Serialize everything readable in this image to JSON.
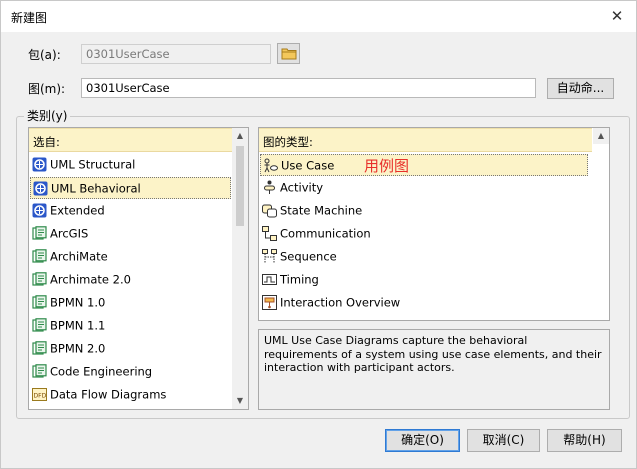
{
  "window": {
    "title": "新建图",
    "close_glyph": "✕"
  },
  "package": {
    "label": "包(a):",
    "value": "0301UserCase"
  },
  "diagram": {
    "label": "图(m):",
    "value": "0301UserCase",
    "auto_name_button": "自动命..."
  },
  "category": {
    "group_label": "类别(y)",
    "from_header": "选自:",
    "types_header": "图的类型:",
    "from_items": [
      {
        "label": "UML Structural",
        "icon": "uml-icon"
      },
      {
        "label": "UML Behavioral",
        "icon": "uml-icon",
        "selected": true
      },
      {
        "label": "Extended",
        "icon": "uml-icon"
      },
      {
        "label": "ArcGIS",
        "icon": "model-icon"
      },
      {
        "label": "ArchiMate",
        "icon": "model-icon"
      },
      {
        "label": "Archimate 2.0",
        "icon": "model-icon"
      },
      {
        "label": "BPMN 1.0",
        "icon": "model-icon"
      },
      {
        "label": "BPMN 1.1",
        "icon": "model-icon"
      },
      {
        "label": "BPMN 2.0",
        "icon": "model-icon"
      },
      {
        "label": "Code Engineering",
        "icon": "model-icon"
      },
      {
        "label": "Data Flow Diagrams",
        "icon": "dfd-icon"
      }
    ],
    "type_items": [
      {
        "label": "Use Case",
        "icon": "use-case-icon",
        "selected": true
      },
      {
        "label": "Activity",
        "icon": "activity-icon"
      },
      {
        "label": "State Machine",
        "icon": "state-machine-icon"
      },
      {
        "label": "Communication",
        "icon": "communication-icon"
      },
      {
        "label": "Sequence",
        "icon": "sequence-icon"
      },
      {
        "label": "Timing",
        "icon": "timing-icon"
      },
      {
        "label": "Interaction Overview",
        "icon": "interaction-overview-icon"
      }
    ],
    "annotation": "用例图",
    "description": "UML Use Case Diagrams capture the behavioral requirements of a system using use case elements, and their interaction with participant actors."
  },
  "buttons": {
    "ok": "确定(O)",
    "cancel": "取消(C)",
    "help": "帮助(H)"
  },
  "colors": {
    "selection": "#fcf3c8",
    "annotation": "#e8302a",
    "uml_icon": "#2b57c9",
    "model_icon": "#2e8a4a"
  }
}
